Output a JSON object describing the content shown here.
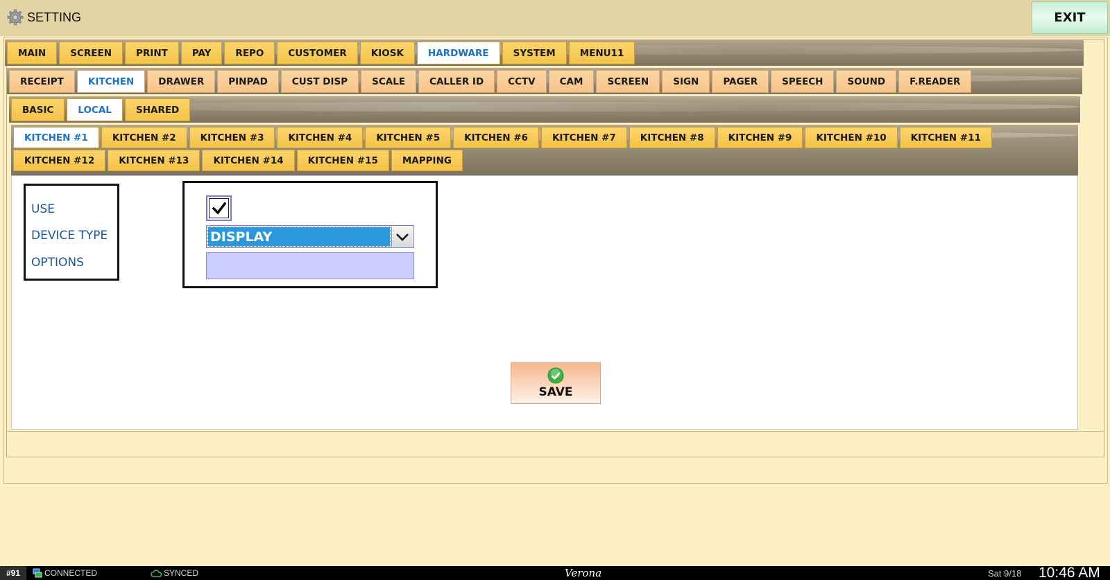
{
  "window": {
    "title": "SETTING",
    "exit_label": "EXIT"
  },
  "tabs_main": [
    {
      "label": "MAIN"
    },
    {
      "label": "SCREEN"
    },
    {
      "label": "PRINT"
    },
    {
      "label": "PAY"
    },
    {
      "label": "REPO"
    },
    {
      "label": "CUSTOMER"
    },
    {
      "label": "KIOSK"
    },
    {
      "label": "HARDWARE",
      "active": true
    },
    {
      "label": "SYSTEM"
    },
    {
      "label": "MENU11"
    }
  ],
  "tabs_hardware": [
    {
      "label": "RECEIPT"
    },
    {
      "label": "KITCHEN",
      "active": true
    },
    {
      "label": "DRAWER"
    },
    {
      "label": "PINPAD"
    },
    {
      "label": "CUST DISP"
    },
    {
      "label": "SCALE"
    },
    {
      "label": "CALLER ID"
    },
    {
      "label": "CCTV"
    },
    {
      "label": "CAM"
    },
    {
      "label": "SCREEN"
    },
    {
      "label": "SIGN"
    },
    {
      "label": "PAGER"
    },
    {
      "label": "SPEECH"
    },
    {
      "label": "SOUND"
    },
    {
      "label": "F.READER"
    }
  ],
  "tabs_scope": [
    {
      "label": "BASIC"
    },
    {
      "label": "LOCAL",
      "active": true
    },
    {
      "label": "SHARED"
    }
  ],
  "tabs_kitchen": [
    {
      "label": "KITCHEN #1",
      "active": true
    },
    {
      "label": "KITCHEN #2"
    },
    {
      "label": "KITCHEN #3"
    },
    {
      "label": "KITCHEN #4"
    },
    {
      "label": "KITCHEN #5"
    },
    {
      "label": "KITCHEN #6"
    },
    {
      "label": "KITCHEN #7"
    },
    {
      "label": "KITCHEN #8"
    },
    {
      "label": "KITCHEN #9"
    },
    {
      "label": "KITCHEN #10"
    },
    {
      "label": "KITCHEN #11"
    },
    {
      "label": "KITCHEN #12"
    },
    {
      "label": "KITCHEN #13"
    },
    {
      "label": "KITCHEN #14"
    },
    {
      "label": "KITCHEN #15"
    },
    {
      "label": "MAPPING"
    }
  ],
  "form": {
    "labels": {
      "use": "USE",
      "device_type": "DEVICE TYPE",
      "options": "OPTIONS"
    },
    "use_checked": true,
    "device_type_value": "DISPLAY",
    "options_value": ""
  },
  "save_label": "SAVE",
  "status": {
    "station": "#91",
    "connection": "CONNECTED",
    "sync": "SYNCED",
    "brand": "Verona",
    "date": "Sat 9/18",
    "time": "10:46 AM"
  },
  "colors": {
    "active_tab_text": "#1a73c9",
    "main_tab_bg": "#f4c449",
    "sub_tab_bg": "#f7c489",
    "select_bg": "#2a99dc",
    "options_bg": "#ccccff"
  }
}
